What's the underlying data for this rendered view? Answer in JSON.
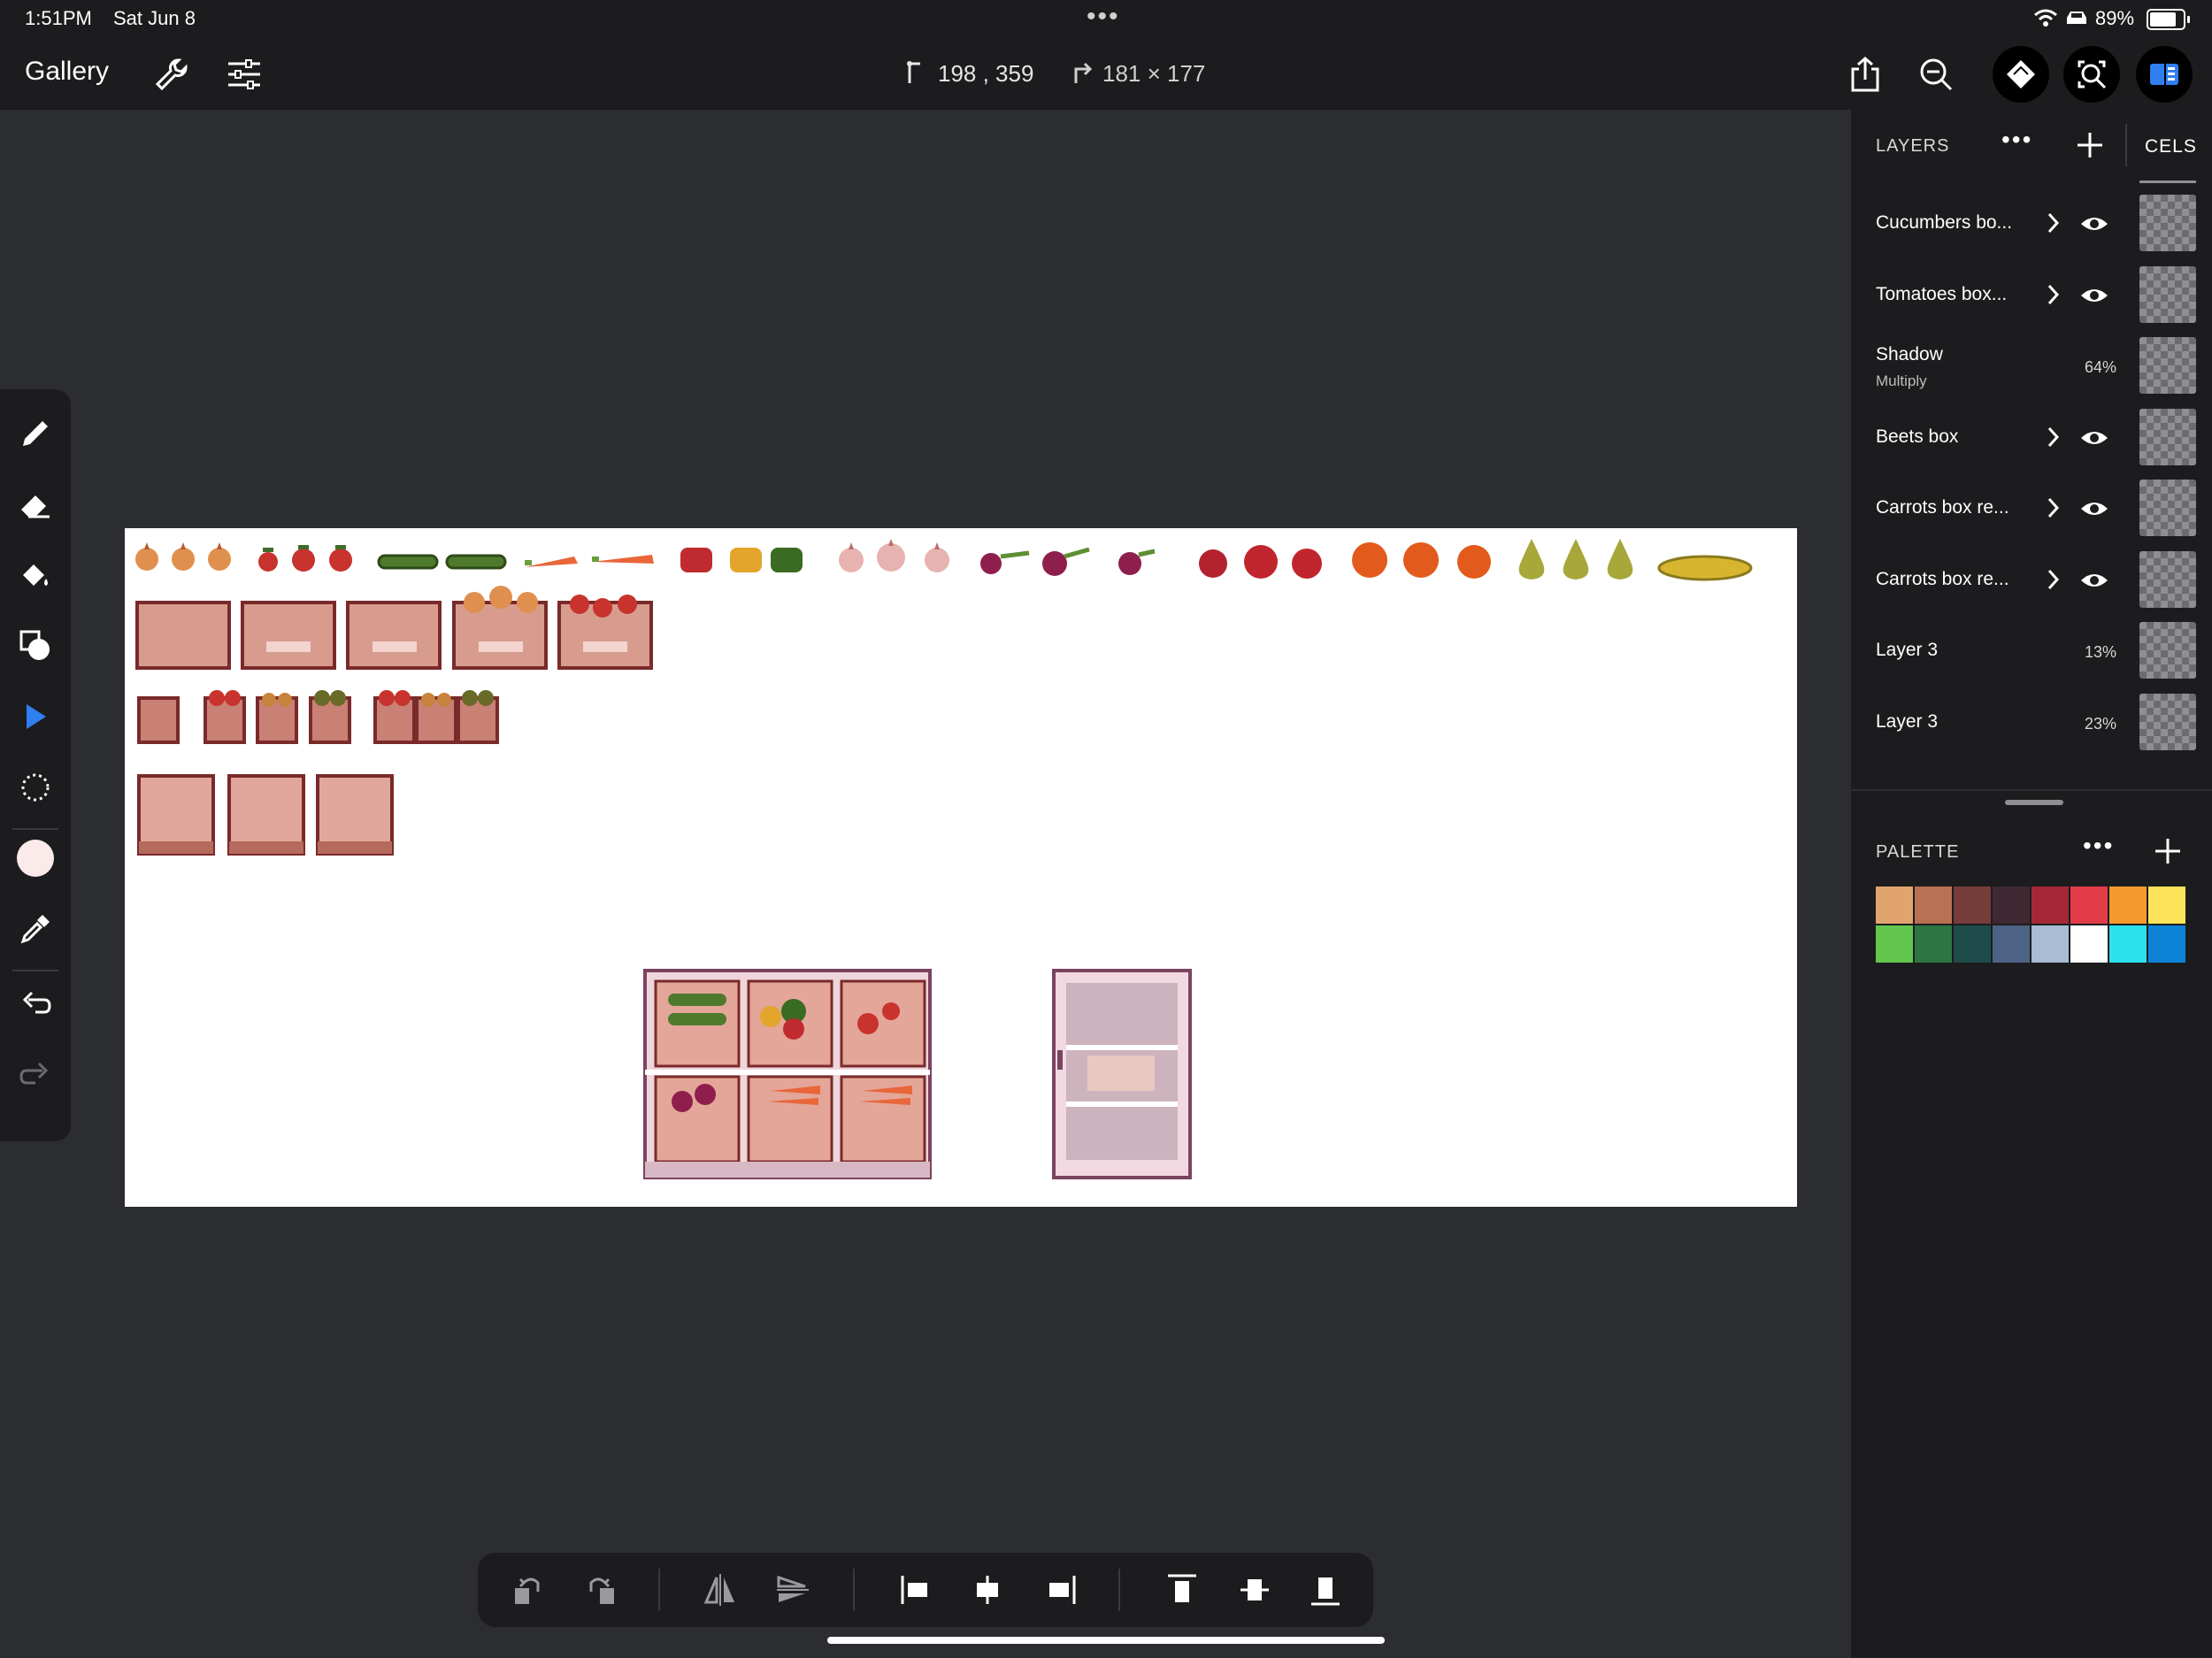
{
  "status_bar": {
    "time": "1:51PM",
    "date": "Sat Jun 8",
    "battery": "89%",
    "battery_level": 0.89
  },
  "toolbar": {
    "gallery": "Gallery",
    "coords": "198 , 359",
    "size": "181 × 177"
  },
  "layers_panel": {
    "title": "LAYERS",
    "cels_tab": "CELS",
    "layers": [
      {
        "name": "Cucumbers bo...",
        "expandable": true,
        "visible": true
      },
      {
        "name": "Tomatoes box...",
        "expandable": true,
        "visible": true
      },
      {
        "name": "Shadow",
        "blend": "Multiply",
        "opacity": "64%"
      },
      {
        "name": "Beets box",
        "expandable": true,
        "visible": true
      },
      {
        "name": "Carrots box re...",
        "expandable": true,
        "visible": true
      },
      {
        "name": "Carrots box re...",
        "expandable": true,
        "visible": true
      },
      {
        "name": "Layer 3",
        "opacity": "13%"
      },
      {
        "name": "Layer 3",
        "opacity": "23%"
      }
    ]
  },
  "palette": {
    "title": "PALETTE",
    "colors": [
      "#e2a46f",
      "#b87152",
      "#773d3a",
      "#3f2832",
      "#a62837",
      "#e33c49",
      "#f79a2e",
      "#fde35a",
      "#63c64d",
      "#2d7543",
      "#1f4b4b",
      "#4d6385",
      "#a9bcd3",
      "#ffffff",
      "#2ce1ec",
      "#0d83d8"
    ]
  },
  "tools": [
    "pencil-icon",
    "eraser-icon",
    "fill-bucket-icon",
    "shape-icon",
    "move-select-icon",
    "lasso-icon",
    "color-swatch",
    "eyedropper-icon",
    "undo-icon",
    "redo-icon"
  ],
  "current_color": "#fbeaea",
  "accent_color": "#2f7ff0"
}
